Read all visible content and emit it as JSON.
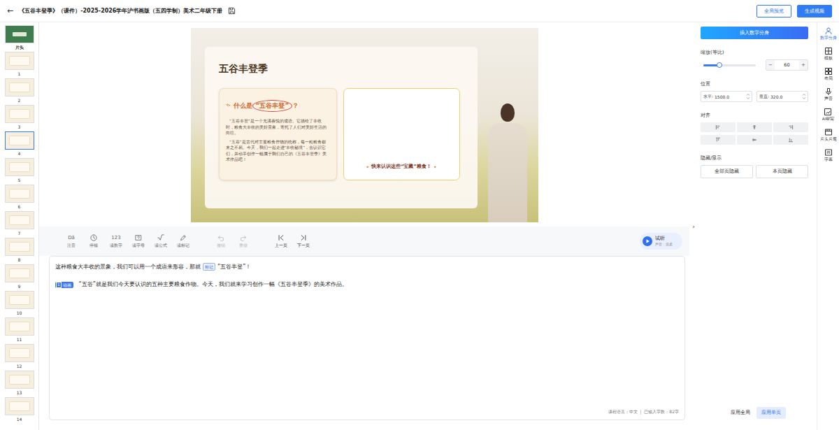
{
  "window": {
    "back": "←",
    "title": "《五谷丰登季》（课件）-2025-2026学年沪书画版（五四学制）美术二年级下册"
  },
  "header_buttons": [
    {
      "label": "全局预览",
      "primary": false
    },
    {
      "label": "生成视频",
      "primary": true
    }
  ],
  "thumbnails": [
    {
      "label": "片头",
      "kind": "cover",
      "selected": false
    },
    {
      "label": "1",
      "kind": "page",
      "selected": false
    },
    {
      "label": "2",
      "kind": "page",
      "selected": false
    },
    {
      "label": "3",
      "kind": "page",
      "selected": false
    },
    {
      "label": "4",
      "kind": "page",
      "selected": true
    },
    {
      "label": "5",
      "kind": "page",
      "selected": false
    },
    {
      "label": "6",
      "kind": "page",
      "selected": false
    },
    {
      "label": "7",
      "kind": "page",
      "selected": false
    },
    {
      "label": "8",
      "kind": "page",
      "selected": false
    },
    {
      "label": "9",
      "kind": "page",
      "selected": false
    },
    {
      "label": "10",
      "kind": "page",
      "selected": false
    },
    {
      "label": "11",
      "kind": "page",
      "selected": false
    },
    {
      "label": "12",
      "kind": "page",
      "selected": false
    },
    {
      "label": "13",
      "kind": "page",
      "selected": false
    },
    {
      "label": "14",
      "kind": "page",
      "selected": false
    }
  ],
  "slide": {
    "title": "五谷丰登季",
    "question": {
      "prefix": "什么是",
      "highlight": "“五谷丰登”",
      "suffix": "？"
    },
    "paragraphs": [
      "“五谷丰登”是一个充满喜悦的成语。它描绘了丰收时，粮食大丰收的美好景象，寄托了人们对美好生活的向往。",
      "“五谷”是古代对主要粮食作物的统称，每一粒粮食都来之不易。今天，我们一起走进“丰收秘境”，去认识它们，并动手创作一幅属于我们自己的《五谷丰登季》美术作品吧！"
    ],
    "banner": {
      "sparkle": "✦",
      "text": "快来认识这些“宝藏”粮食！"
    }
  },
  "toolbar": {
    "tools": [
      {
        "glyph": "Dǎ",
        "label": "注音"
      },
      {
        "label": "停顿"
      },
      {
        "glyph": "123",
        "label": "读数字"
      },
      {
        "label": "读字母"
      },
      {
        "label": "读公式"
      },
      {
        "label": "读标记"
      }
    ],
    "history": [
      {
        "label": "撤销",
        "disabled": true
      },
      {
        "label": "重做",
        "disabled": true
      }
    ],
    "nav": [
      {
        "label": "上一页"
      },
      {
        "label": "下一页"
      }
    ],
    "preview": {
      "label": "试听",
      "voice": "声音：温柔"
    }
  },
  "script": {
    "paragraphs": [
      {
        "segments": [
          {
            "kind": "text",
            "text": "这种粮食大丰收的景象，我们可以用一个成语来形容，那就"
          },
          {
            "kind": "tag",
            "text": "标记"
          },
          {
            "kind": "text",
            "text": "“五谷丰登”！"
          }
        ]
      },
      {
        "badge": {
          "number": "1",
          "label": "动画"
        },
        "segments": [
          {
            "kind": "text",
            "text": "“五谷”就是我们今天要认识的五种主要粮食作物。今天，我们就来学习创作一幅《五谷丰登季》的美术作品。"
          }
        ]
      }
    ]
  },
  "status": {
    "language": "课程语言：中文",
    "count": "已输入字数：82字"
  },
  "collapse": "›",
  "panel": {
    "insert_button": "插入数字分身",
    "scale": {
      "label": "缩放(等比)",
      "level": 0.3,
      "value": "60",
      "minus": "−",
      "plus": "+"
    },
    "position": {
      "label": "位置",
      "fields": [
        {
          "label": "水平:",
          "value": "1500.0"
        },
        {
          "label": "垂直:",
          "value": "320.0"
        }
      ]
    },
    "align": {
      "label": "对齐",
      "buttons": [
        {
          "selected": false
        },
        {
          "selected": false
        },
        {
          "selected": false
        },
        {
          "selected": false
        },
        {
          "selected": false
        },
        {
          "selected": false
        }
      ]
    },
    "visibility": {
      "label": "隐藏/显示",
      "buttons": [
        {
          "label": "全部页隐藏",
          "selected": false
        },
        {
          "label": "本页隐藏",
          "selected": false
        }
      ]
    },
    "apply": [
      {
        "label": "应用全局",
        "selected": false
      },
      {
        "label": "应用单页",
        "selected": true
      }
    ]
  },
  "rail": [
    {
      "label": "数字分身",
      "selected": true
    },
    {
      "label": "模板",
      "selected": false
    },
    {
      "label": "布局",
      "selected": false
    },
    {
      "label": "声音",
      "selected": false
    },
    {
      "label": "AI帮写",
      "selected": false
    },
    {
      "label": "片头片尾",
      "selected": false
    },
    {
      "label": "字幕",
      "selected": false
    }
  ]
}
